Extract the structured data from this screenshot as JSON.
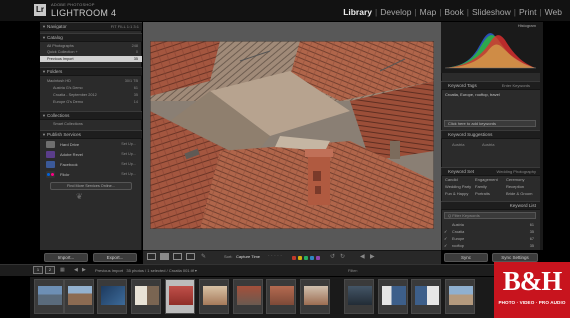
{
  "app": {
    "vendor": "ADOBE PHOTOSHOP",
    "title": "LIGHTROOM 4",
    "badge": "Lr"
  },
  "modules": {
    "items": [
      "Library",
      "Develop",
      "Map",
      "Book",
      "Slideshow",
      "Print",
      "Web"
    ],
    "active": "Library"
  },
  "left_panel": {
    "navigator": {
      "label": "Navigator",
      "options": "FIT FILL 1:1 3:1"
    },
    "catalog": {
      "label": "Catalog",
      "rows": [
        {
          "name": "All Photographs",
          "count": "248"
        },
        {
          "name": "Quick Collection +",
          "count": "0"
        },
        {
          "name": "Previous Import",
          "count": "35"
        }
      ]
    },
    "folders": {
      "label": "Folders",
      "volume": {
        "name": "Macintosh HD",
        "info": "30/1 TB"
      },
      "rows": [
        {
          "name": "Austria G's Demo",
          "count": "61"
        },
        {
          "name": "Croatia - September 2012",
          "count": "35"
        },
        {
          "name": "Europe G's Demo",
          "count": "14"
        }
      ]
    },
    "collections": {
      "label": "Collections",
      "rows": [
        {
          "name": "Smart Collections",
          "count": ""
        }
      ]
    },
    "publish_services": {
      "label": "Publish Services",
      "rows": [
        {
          "name": "Hard Drive",
          "action": "Set Up..."
        },
        {
          "name": "Adobe Revel",
          "action": "Set Up..."
        },
        {
          "name": "Facebook",
          "action": "Set Up..."
        },
        {
          "name": "Flickr",
          "action": "Set Up..."
        }
      ],
      "find_more": "Find More Services Online..."
    },
    "import_label": "Import...",
    "export_label": "Export..."
  },
  "toolbar": {
    "sort_label": "Sort:",
    "sort_value": "Capture Time",
    "colors": [
      "#c0392b",
      "#d4ac0d",
      "#27ae60",
      "#2e86c1",
      "#8e44ad"
    ]
  },
  "right_panel": {
    "histogram_label": "Histogram",
    "keyword_tags": {
      "label": "Keyword Tags",
      "mode": "Enter Keywords",
      "value": "Croatia, Europe, rooftop, travel",
      "placeholder": "Click here to add keywords"
    },
    "keyword_suggestions": {
      "label": "Keyword Suggestions",
      "items": [
        "Austria",
        "Austria"
      ]
    },
    "keyword_set": {
      "label": "Keyword Set",
      "set_name": "Wedding Photography",
      "items": [
        "Candid",
        "Engagement",
        "Ceremony",
        "Wedding Party",
        "Family",
        "Reception",
        "Fun & Happy",
        "Portraits",
        "Bride & Groom"
      ]
    },
    "keyword_list": {
      "label": "Keyword List",
      "filter_placeholder": "Q Filter Keywords",
      "rows": [
        {
          "name": "Austria",
          "count": "61",
          "checked": false
        },
        {
          "name": "Croatia",
          "count": "35",
          "checked": true
        },
        {
          "name": "Europe",
          "count": "67",
          "checked": true
        },
        {
          "name": "rooftop",
          "count": "35",
          "checked": true
        }
      ]
    },
    "sync_label": "Sync",
    "sync_settings_label": "Sync Settings"
  },
  "filmstrip": {
    "tabs": [
      "1",
      "2"
    ],
    "source": "Previous Import",
    "info": "35 photos / 1 selected / Croatia 001.tif ▾",
    "filter_label": "Filter:"
  },
  "logo": {
    "text": "B&H",
    "tagline": "PHOTO · VIDEO · PRO AUDIO"
  }
}
